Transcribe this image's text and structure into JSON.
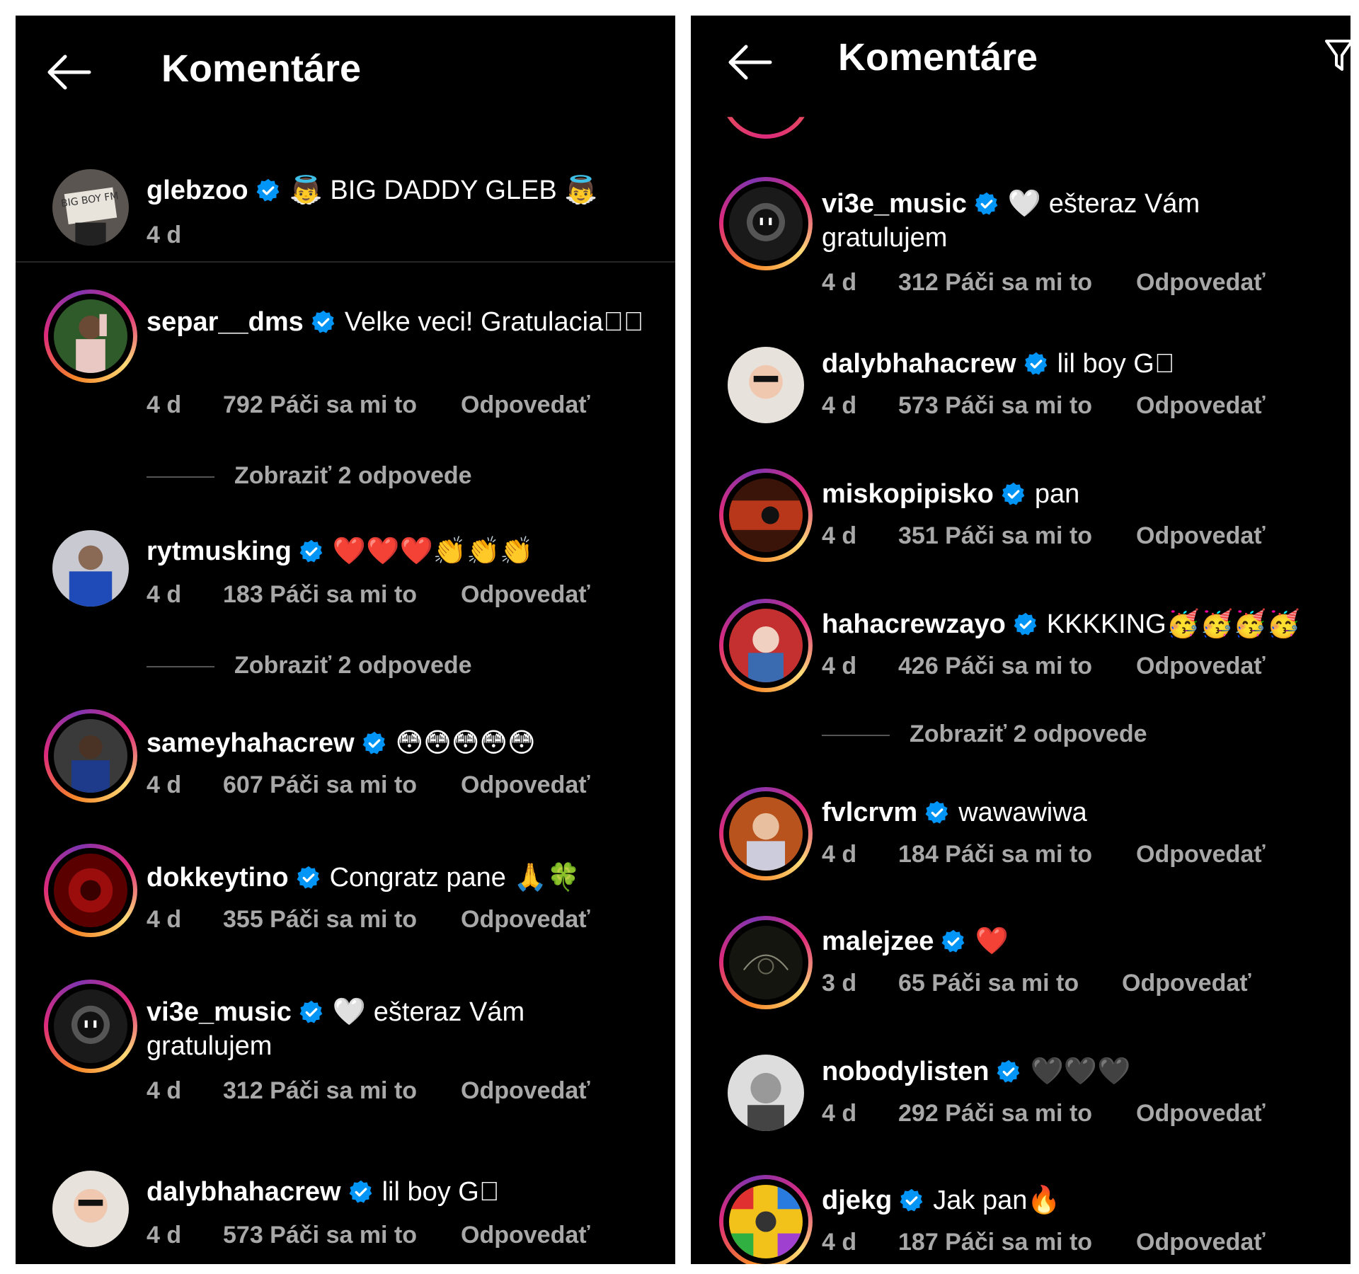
{
  "left": {
    "title": "Komentáre",
    "caption": {
      "user": "glebzoo",
      "text": "👼 BIG DADDY GLEB 👼",
      "time": "4 d",
      "avatar_text": "BIG BOY FM"
    },
    "comments": [
      {
        "user": "separ__dms",
        "text": "Velke veci! Gratulacia🏻🏼",
        "time": "4 d",
        "likes": "792 Páči sa mi to",
        "reply": "Odpovedať",
        "view_replies": "Zobraziť 2 odpovede"
      },
      {
        "user": "rytmusking",
        "text": "❤️❤️❤️👏👏👏",
        "time": "4 d",
        "likes": "183 Páči sa mi to",
        "reply": "Odpovedať",
        "view_replies": "Zobraziť 2 odpovede"
      },
      {
        "user": "sameyhahacrew",
        "text": "😳😳😳😳😳",
        "time": "4 d",
        "likes": "607 Páči sa mi to",
        "reply": "Odpovedať"
      },
      {
        "user": "dokkeytino",
        "text": "Congratz pane 🙏🍀",
        "time": "4 d",
        "likes": "355 Páči sa mi to",
        "reply": "Odpovedať"
      },
      {
        "user": "vi3e_music",
        "text": "🤍 ešteraz Vám gratulujem",
        "time": "4 d",
        "likes": "312 Páči sa mi to",
        "reply": "Odpovedať"
      },
      {
        "user": "dalybhahacrew",
        "text": "lil boy G🏻",
        "time": "4 d",
        "likes": "573 Páči sa mi to",
        "reply": "Odpovedať"
      }
    ]
  },
  "right": {
    "title": "Komentáre",
    "comments": [
      {
        "user": "vi3e_music",
        "text": "🤍 ešteraz Vám gratulujem",
        "time": "4 d",
        "likes": "312 Páči sa mi to",
        "reply": "Odpovedať"
      },
      {
        "user": "dalybhahacrew",
        "text": "lil boy G🏻",
        "time": "4 d",
        "likes": "573 Páči sa mi to",
        "reply": "Odpovedať"
      },
      {
        "user": "miskopipisko",
        "text": "pan",
        "time": "4 d",
        "likes": "351 Páči sa mi to",
        "reply": "Odpovedať"
      },
      {
        "user": "hahacrewzayo",
        "text": "KKKKING🥳🥳🥳🥳",
        "time": "4 d",
        "likes": "426 Páči sa mi to",
        "reply": "Odpovedať",
        "view_replies": "Zobraziť 2 odpovede"
      },
      {
        "user": "fvlcrvm",
        "text": "wawawiwa",
        "time": "4 d",
        "likes": "184 Páči sa mi to",
        "reply": "Odpovedať"
      },
      {
        "user": "malejzee",
        "text": "❤️",
        "time": "3 d",
        "likes": "65 Páči sa mi to",
        "reply": "Odpovedať"
      },
      {
        "user": "nobodylisten",
        "text": "🖤🖤🖤",
        "time": "4 d",
        "likes": "292 Páči sa mi to",
        "reply": "Odpovedať"
      },
      {
        "user": "djekg",
        "text": "Jak pan🔥",
        "time": "4 d",
        "likes": "187 Páči sa mi to",
        "reply": "Odpovedať"
      }
    ]
  },
  "colors": {
    "background": "#000000",
    "meta": "#a8a8a8",
    "verified": "#0095f6",
    "divider": "#262626"
  }
}
